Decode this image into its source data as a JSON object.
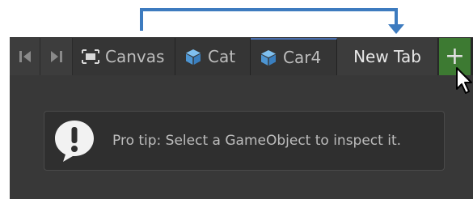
{
  "colors": {
    "connector": "#3d7bbf",
    "window_bg": "#383838",
    "tabbar_bg": "#282828",
    "add_button_bg": "#3d7a32",
    "tip_text": "#bcbcbc",
    "cube_icon": "#5ea8e6"
  },
  "tabbar": {
    "nav_first_icon": "skip-to-start-icon",
    "nav_last_icon": "skip-to-end-icon",
    "tabs": [
      {
        "label": "Canvas",
        "icon": "canvas-frame-icon"
      },
      {
        "label": "Cat",
        "icon": "cube-icon"
      },
      {
        "label": "Car4",
        "icon": "cube-icon"
      },
      {
        "label": "New Tab",
        "icon": "",
        "active": true
      }
    ],
    "add_label": "+"
  },
  "tip": {
    "icon": "exclamation-bubble-icon",
    "text": "Pro tip: Select a GameObject to inspect it."
  }
}
